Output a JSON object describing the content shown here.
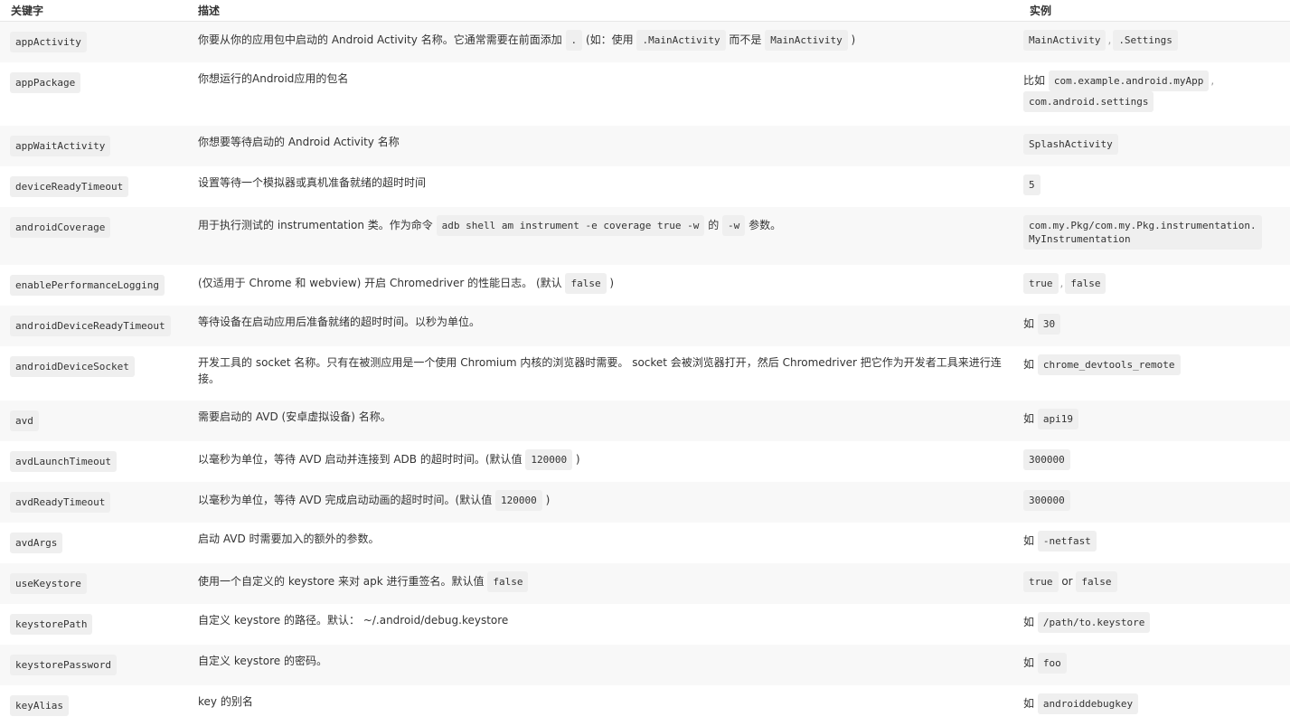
{
  "headers": {
    "key": "关键字",
    "desc": "描述",
    "example": "实例"
  },
  "rows": [
    {
      "key": "appActivity",
      "desc": [
        {
          "t": "你要从你的应用包中启动的 Android Activity 名称。它通常需要在前面添加 "
        },
        {
          "c": "."
        },
        {
          "t": " (如：使用 "
        },
        {
          "c": ".MainActivity"
        },
        {
          "t": " 而不是 "
        },
        {
          "c": "MainActivity"
        },
        {
          "t": " )"
        }
      ],
      "example": [
        {
          "c": "MainActivity"
        },
        {
          "s": ","
        },
        {
          "c": ".Settings"
        }
      ]
    },
    {
      "key": "appPackage",
      "desc": [
        {
          "t": "你想运行的Android应用的包名"
        }
      ],
      "example": [
        {
          "t": "比如 "
        },
        {
          "c": "com.example.android.myApp"
        },
        {
          "s": ","
        },
        {
          "br": true
        },
        {
          "c": "com.android.settings"
        }
      ]
    },
    {
      "key": "appWaitActivity",
      "desc": [
        {
          "t": "你想要等待启动的 Android Activity 名称"
        }
      ],
      "example": [
        {
          "c": "SplashActivity"
        }
      ]
    },
    {
      "key": "deviceReadyTimeout",
      "desc": [
        {
          "t": "设置等待一个模拟器或真机准备就绪的超时时间"
        }
      ],
      "example": [
        {
          "c": "5"
        }
      ]
    },
    {
      "key": "androidCoverage",
      "desc": [
        {
          "t": "用于执行测试的 instrumentation 类。作为命令 "
        },
        {
          "c": "adb shell am instrument -e coverage true -w"
        },
        {
          "t": " 的 "
        },
        {
          "c": "-w"
        },
        {
          "t": " 参数。"
        }
      ],
      "example": [
        {
          "c": "com.my.Pkg/com.my.Pkg.instrumentation.\nMyInstrumentation"
        }
      ]
    },
    {
      "key": "enablePerformanceLogging",
      "desc": [
        {
          "t": "(仅适用于 Chrome 和 webview) 开启 Chromedriver 的性能日志。 (默认 "
        },
        {
          "c": "false"
        },
        {
          "t": " )"
        }
      ],
      "example": [
        {
          "c": "true"
        },
        {
          "s": ","
        },
        {
          "c": "false"
        }
      ]
    },
    {
      "key": "androidDeviceReadyTimeout",
      "desc": [
        {
          "t": "等待设备在启动应用后准备就绪的超时时间。以秒为单位。"
        }
      ],
      "example": [
        {
          "t": "如 "
        },
        {
          "c": "30"
        }
      ]
    },
    {
      "key": "androidDeviceSocket",
      "desc": [
        {
          "t": "开发工具的 socket 名称。只有在被测应用是一个使用 Chromium 内核的浏览器时需要。 socket 会被浏览器打开，然后 Chromedriver 把它作为开发者工具来进行连接。"
        }
      ],
      "example": [
        {
          "t": "如 "
        },
        {
          "c": "chrome_devtools_remote"
        }
      ]
    },
    {
      "key": "avd",
      "desc": [
        {
          "t": "需要启动的 AVD (安卓虚拟设备) 名称。"
        }
      ],
      "example": [
        {
          "t": "如 "
        },
        {
          "c": "api19"
        }
      ]
    },
    {
      "key": "avdLaunchTimeout",
      "desc": [
        {
          "t": "以毫秒为单位，等待 AVD 启动并连接到 ADB 的超时时间。(默认值 "
        },
        {
          "c": "120000"
        },
        {
          "t": " )"
        }
      ],
      "example": [
        {
          "c": "300000"
        }
      ]
    },
    {
      "key": "avdReadyTimeout",
      "desc": [
        {
          "t": "以毫秒为单位，等待 AVD 完成启动动画的超时时间。(默认值 "
        },
        {
          "c": "120000"
        },
        {
          "t": " )"
        }
      ],
      "example": [
        {
          "c": "300000"
        }
      ]
    },
    {
      "key": "avdArgs",
      "desc": [
        {
          "t": "启动 AVD 时需要加入的额外的参数。"
        }
      ],
      "example": [
        {
          "t": "如 "
        },
        {
          "c": "-netfast"
        }
      ]
    },
    {
      "key": "useKeystore",
      "desc": [
        {
          "t": "使用一个自定义的 keystore 来对 apk 进行重签名。默认值 "
        },
        {
          "c": "false"
        }
      ],
      "example": [
        {
          "c": "true"
        },
        {
          "t": " or "
        },
        {
          "c": "false"
        }
      ]
    },
    {
      "key": "keystorePath",
      "desc": [
        {
          "t": "自定义 keystore 的路径。默认： ~/.android/debug.keystore"
        }
      ],
      "example": [
        {
          "t": "如 "
        },
        {
          "c": "/path/to.keystore"
        }
      ]
    },
    {
      "key": "keystorePassword",
      "desc": [
        {
          "t": "自定义 keystore 的密码。"
        }
      ],
      "example": [
        {
          "t": "如 "
        },
        {
          "c": "foo"
        }
      ]
    },
    {
      "key": "keyAlias",
      "desc": [
        {
          "t": "key 的别名"
        }
      ],
      "example": [
        {
          "t": "如 "
        },
        {
          "c": "androiddebugkey"
        }
      ]
    }
  ]
}
